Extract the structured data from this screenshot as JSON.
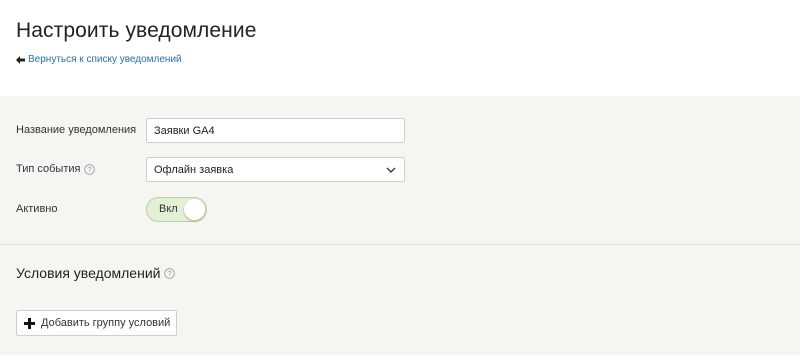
{
  "header": {
    "title": "Настроить уведомление",
    "back_link": "Вернуться к списку уведомлений"
  },
  "form": {
    "name": {
      "label": "Название уведомления",
      "value": "Заявки GA4"
    },
    "event_type": {
      "label": "Тип события",
      "value": "Офлайн заявка"
    },
    "active": {
      "label": "Активно",
      "toggle_label": "Вкл",
      "on": true
    }
  },
  "conditions": {
    "title": "Условия уведомлений",
    "add_button": "Добавить группу условий"
  },
  "icons": {
    "back": "arrow-left-icon",
    "help": "question-circle-icon",
    "dropdown": "chevron-down-icon",
    "add": "plus-icon"
  },
  "colors": {
    "link": "#2f6fa8",
    "toggle_bg": "#e3efd6",
    "toggle_border": "#b9d3a0",
    "page_bg": "#f6f5f2"
  }
}
